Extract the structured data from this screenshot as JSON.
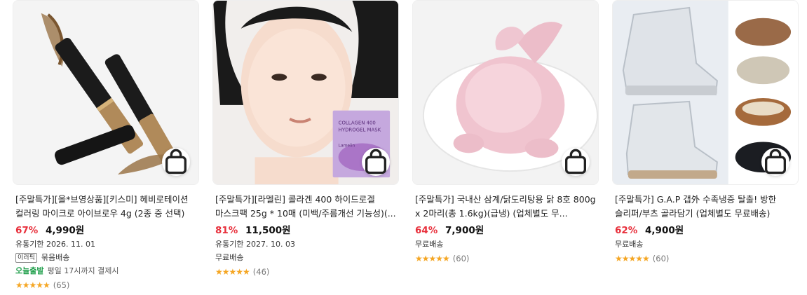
{
  "products": [
    {
      "title": "[주말특가][올*브영상품][키스미] 헤비로테이션 컬러링 마이크로 아이브로우 4g (2종 중 선택)",
      "discount": "67%",
      "price": "4,990원",
      "expiry": "유통기한 2026. 11. 01",
      "badge": "이러픽",
      "bundle": "묶음배송",
      "today_label": "오늘출발",
      "today_text": "평일 17시까지 결제시",
      "stars": "★★★★★",
      "reviews": "(65)"
    },
    {
      "title": "[주말특가][라멜린] 콜라겐 400 하이드로겔 마스크팩 25g * 10매 (미백/주름개선 기능성)(...",
      "discount": "81%",
      "price": "11,500원",
      "expiry": "유통기한 2027. 10. 03",
      "shipping": "무료배송",
      "stars": "★★★★★",
      "reviews": "(46)",
      "pack_text": [
        "COLLAGEN 400",
        "HYDROGEL MASK",
        "Lamelin"
      ]
    },
    {
      "title": "[주말특가] 국내산 삼계/닭도리탕용 닭 8호 800g x 2마리(총 1.6kg)(급냉) (업체별도 무...",
      "discount": "64%",
      "price": "7,900원",
      "shipping": "무료배송",
      "stars": "★★★★★",
      "reviews": "(60)"
    },
    {
      "title": "[주말특가] G.A.P 갭外 수족냉증 탈출! 방한 슬리퍼/부츠 골라담기 (업체별도 무료배송)",
      "discount": "62%",
      "price": "4,900원",
      "shipping": "무료배송",
      "stars": "★★★★★",
      "reviews": "(60)"
    }
  ],
  "colors": {
    "discount": "#e8303c",
    "star": "#f5a623",
    "today": "#1e9e4a"
  },
  "icons": {
    "cart": "shopping-bag-icon"
  }
}
